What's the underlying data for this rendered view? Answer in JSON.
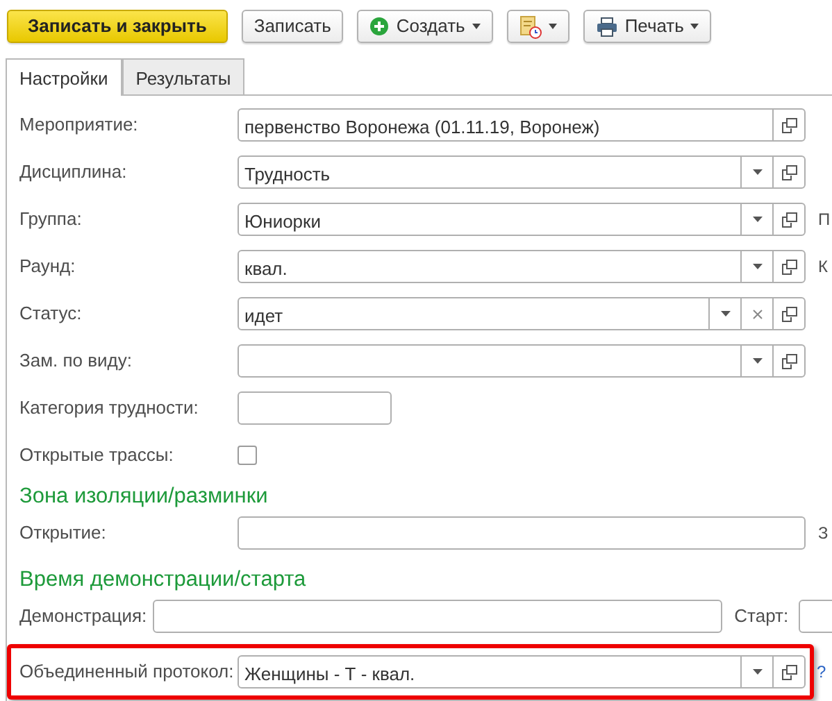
{
  "toolbar": [
    {
      "kind": "primary",
      "label": "Записать и закрыть"
    },
    {
      "kind": "plain",
      "label": "Записать"
    },
    {
      "kind": "create",
      "label": "Создать",
      "caret": true
    },
    {
      "kind": "report",
      "caret": true
    },
    {
      "kind": "print",
      "label": "Печать",
      "caret": true
    }
  ],
  "tabs": [
    {
      "label": "Настройки",
      "selected": true
    },
    {
      "label": "Результаты",
      "selected": false
    }
  ],
  "rows": [
    {
      "kind": "field",
      "label": "Мероприятие:",
      "value": "первенство Воронежа (01.11.19, Воронеж)",
      "dropdown": false,
      "clear": false,
      "open": true
    },
    {
      "kind": "field",
      "label": "Дисциплина:",
      "value": "Трудность",
      "dropdown": true,
      "clear": false,
      "open": true
    },
    {
      "kind": "field",
      "label": "Группа:",
      "value": "Юниорки",
      "dropdown": true,
      "clear": false,
      "open": true,
      "side": "П"
    },
    {
      "kind": "field",
      "label": "Раунд:",
      "value": "квал.",
      "dropdown": true,
      "clear": false,
      "open": true,
      "side": "К"
    },
    {
      "kind": "field",
      "label": "Статус:",
      "value": "идет",
      "dropdown": true,
      "clear": true,
      "open": true
    },
    {
      "kind": "field",
      "label": "Зам. по виду:",
      "dropdown": true,
      "clear": false,
      "open": true
    },
    {
      "kind": "short",
      "label": "Категория трудности:"
    },
    {
      "kind": "checkbox",
      "label": "Открытые трассы:",
      "checked": false
    },
    {
      "kind": "heading",
      "label": "Зона изоляции/разминки"
    },
    {
      "kind": "field",
      "label": "Открытие:",
      "dropdown": false,
      "clear": false,
      "open": false,
      "side": "З"
    },
    {
      "kind": "heading",
      "label": "Время демонстрации/старта"
    },
    {
      "kind": "pair",
      "label": "Демонстрация:",
      "label2": "Старт:"
    },
    {
      "kind": "highlight",
      "label": "Объединенный протокол:",
      "value": "Женщины - Т - квал.",
      "dropdown": true,
      "clear": false,
      "open": true,
      "side": "?"
    }
  ]
}
